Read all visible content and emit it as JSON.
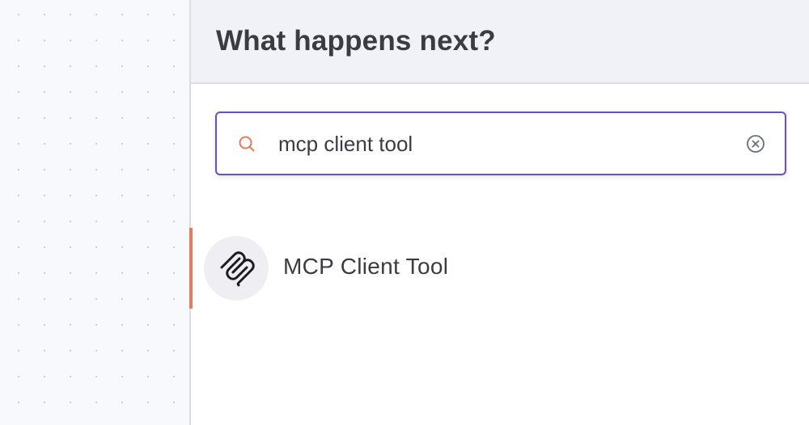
{
  "panel": {
    "title": "What happens next?"
  },
  "search": {
    "value": "mcp client tool",
    "icon": "search-icon",
    "clear_icon": "close-circle-icon"
  },
  "results": [
    {
      "label": "MCP Client Tool",
      "icon": "mcp-icon",
      "selected": true
    }
  ],
  "colors": {
    "accent": "#ea7a5d",
    "focus_border": "#6b4fc4",
    "text": "#3b3b42",
    "header_bg": "#f1f2f7"
  }
}
